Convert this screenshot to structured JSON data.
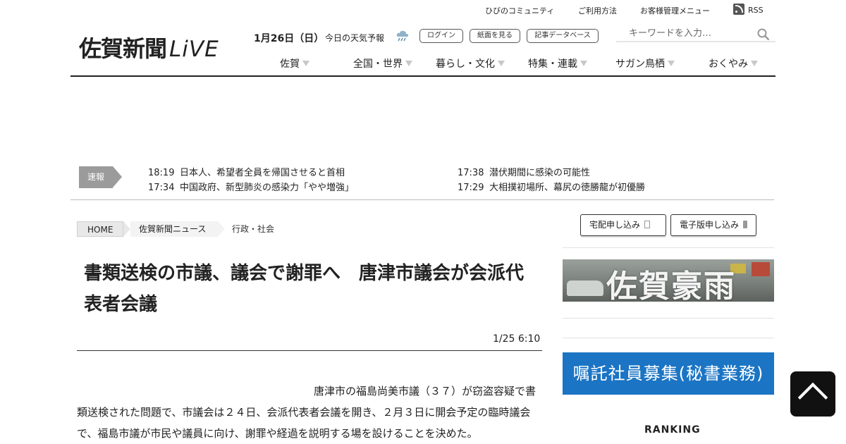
{
  "utility_links": [
    "ひびのコミュニティ",
    "ご利用方法",
    "お客様管理メニュー"
  ],
  "rss_label": "RSS",
  "logo": {
    "main": "佐賀新聞",
    "live": "LiVE"
  },
  "header": {
    "date": "1月26日（日）",
    "weather_label": "今日の天気予報",
    "login_label": "ログイン",
    "paper_label": "紙面を見る",
    "database_label": "記事データベース"
  },
  "search": {
    "placeholder": "キーワードを入力…"
  },
  "nav": [
    "佐賀",
    "全国・世界",
    "暮らし・文化",
    "特集・連載",
    "サガン鳥栖",
    "おくやみ"
  ],
  "breaking": {
    "label": "速報",
    "items": [
      {
        "time": "18:19",
        "text": "日本人、希望者全員を帰国させると首相"
      },
      {
        "time": "17:38",
        "text": "潜伏期間に感染の可能性"
      },
      {
        "time": "17:34",
        "text": "中国政府、新型肺炎の感染力「やや増強」"
      },
      {
        "time": "17:29",
        "text": "大相撲初場所、幕尻の徳勝龍が初優勝"
      }
    ]
  },
  "breadcrumb": [
    "HOME",
    "佐賀新聞ニュース",
    "行政・社会"
  ],
  "article": {
    "title": "書類送検の市議、議会で謝罪へ　唐津市議会が会派代表者会議",
    "date": "1/25 6:10",
    "body": "唐津市の福島尚美市議（３７）が窃盗容疑で書類送検された問題で、市議会は２４日、会派代表者会議を開き、２月３日に開会予定の臨時議会で、福島市議が市民や議員に向け、謝罪や経過を説明する場を設けることを決めた。"
  },
  "sidebar": {
    "delivery_button": "宅配申し込み",
    "digital_button": "電子版申し込み",
    "rain_banner": "佐賀豪雨",
    "recruit_banner": "嘱託社員募集(秘書業務)",
    "ranking_title": "RANKING"
  },
  "icons": {
    "weather": "rain-cloud-icon",
    "search": "search-icon",
    "rss": "rss-icon",
    "back_to_top": "chevron-up-icon"
  },
  "colors": {
    "recruit_banner": "#1b74c4",
    "breaking_label": "#9b9b9b",
    "back_to_top": "#111111"
  }
}
